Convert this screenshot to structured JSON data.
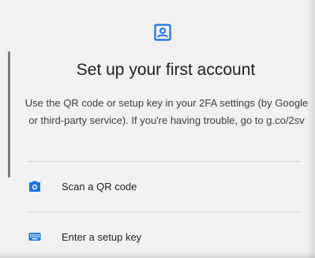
{
  "header": {
    "icon": "account-box-icon",
    "title": "Set up your first account",
    "description": "Use the QR code or setup key in your 2FA settings (by Google or third-party service). If you're having trouble, go to g.co/2sv"
  },
  "options": [
    {
      "icon": "camera-icon",
      "label": "Scan a QR code"
    },
    {
      "icon": "keyboard-icon",
      "label": "Enter a setup key"
    }
  ],
  "colors": {
    "accent": "#1a73e8",
    "background": "#f1f1f1",
    "text": "#202124",
    "divider": "#d6d6d6"
  }
}
